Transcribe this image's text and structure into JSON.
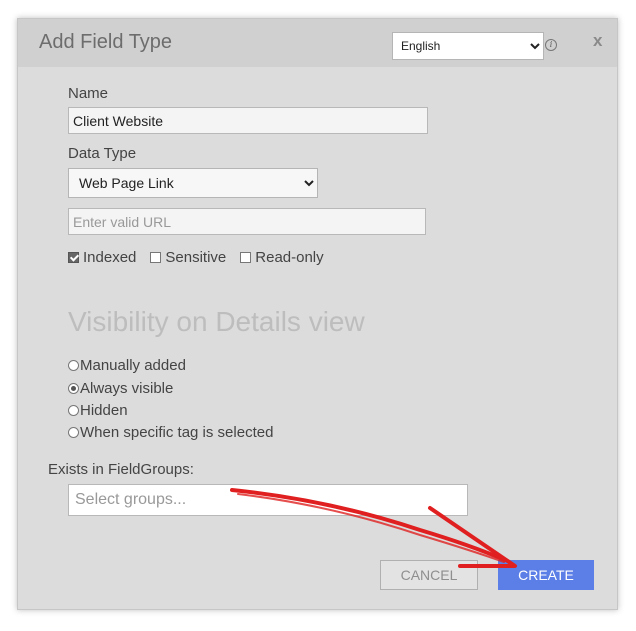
{
  "dialog": {
    "title": "Add Field Type",
    "language_selected": "English",
    "close_label": "x"
  },
  "form": {
    "name_label": "Name",
    "name_value": "Client Website",
    "data_type_label": "Data Type",
    "data_type_selected": "Web Page Link",
    "url_placeholder": "Enter valid URL",
    "checkboxes": [
      {
        "label": "Indexed",
        "checked": true
      },
      {
        "label": "Sensitive",
        "checked": false
      },
      {
        "label": "Read-only",
        "checked": false
      }
    ]
  },
  "visibility": {
    "heading": "Visibility on Details view",
    "options": [
      {
        "label": "Manually added",
        "checked": false
      },
      {
        "label": "Always visible",
        "checked": true
      },
      {
        "label": "Hidden",
        "checked": false
      },
      {
        "label": "When specific tag is selected",
        "checked": false
      }
    ]
  },
  "field_groups": {
    "label": "Exists in FieldGroups:",
    "placeholder": "Select groups..."
  },
  "buttons": {
    "cancel": "CANCEL",
    "create": "CREATE"
  },
  "colors": {
    "primary": "#5b7fe6",
    "arrow": "#e02020"
  }
}
